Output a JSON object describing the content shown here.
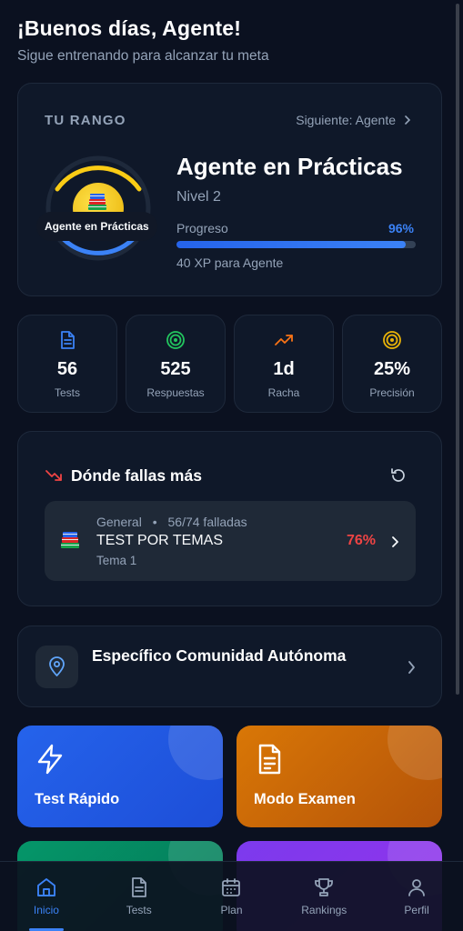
{
  "header": {
    "greeting": "¡Buenos días, Agente!",
    "subtitle": "Sigue entrenando para alcanzar tu meta"
  },
  "rank": {
    "label": "TU RANGO",
    "next_link": "Siguiente: Agente",
    "badge_label": "Agente en Prácticas",
    "title": "Agente en Prácticas",
    "level": "Nivel 2",
    "progress_label": "Progreso",
    "progress_pct_text": "96%",
    "progress_value": 0.96,
    "xp_text": "40 XP para Agente"
  },
  "stats": [
    {
      "icon": "document-icon",
      "value": "56",
      "label": "Tests",
      "color": "#3b82f6"
    },
    {
      "icon": "target-icon",
      "value": "525",
      "label": "Respuestas",
      "color": "#22c55e"
    },
    {
      "icon": "trending-up-icon",
      "value": "1d",
      "label": "Racha",
      "color": "#f97316"
    },
    {
      "icon": "bullseye-icon",
      "value": "25%",
      "label": "Precisión",
      "color": "#eab308"
    }
  ],
  "fails": {
    "title": "Dónde fallas más",
    "item": {
      "category": "General",
      "separator": "•",
      "count": "56/74 falladas",
      "name": "TEST POR TEMAS",
      "sub": "Tema 1",
      "pct": "76%"
    }
  },
  "region": {
    "title": "Específico Comunidad Autónoma"
  },
  "actions": [
    {
      "label": "Test Rápido",
      "icon": "lightning-icon"
    },
    {
      "label": "Modo Examen",
      "icon": "clipboard-icon"
    }
  ],
  "nav": [
    {
      "label": "Inicio",
      "icon": "home-icon",
      "active": true
    },
    {
      "label": "Tests",
      "icon": "document-icon"
    },
    {
      "label": "Plan",
      "icon": "calendar-icon"
    },
    {
      "label": "Rankings",
      "icon": "trophy-icon"
    },
    {
      "label": "Perfil",
      "icon": "user-icon"
    }
  ],
  "colors": {
    "accent": "#3b82f6",
    "danger": "#ef4444",
    "background": "#0b1120"
  }
}
